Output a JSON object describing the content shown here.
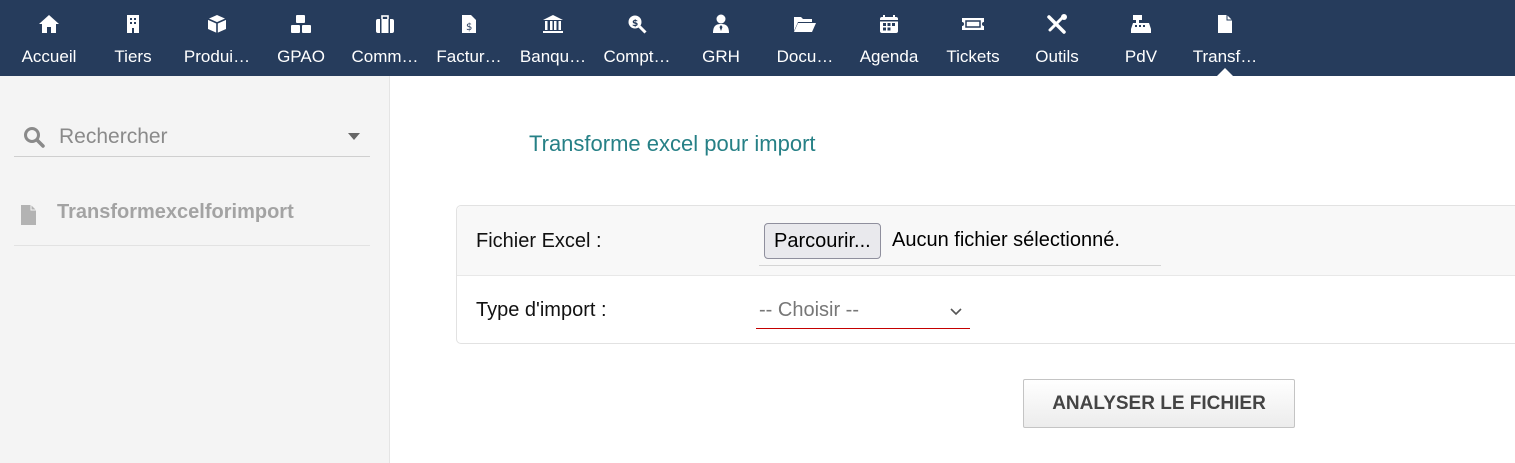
{
  "nav": {
    "items": [
      {
        "label": "Accueil",
        "icon": "home-icon"
      },
      {
        "label": "Tiers",
        "icon": "building-icon"
      },
      {
        "label": "Produi…",
        "icon": "cube-icon"
      },
      {
        "label": "GPAO",
        "icon": "cubes-icon"
      },
      {
        "label": "Comm…",
        "icon": "suitcase-icon"
      },
      {
        "label": "Factur…",
        "icon": "invoice-icon"
      },
      {
        "label": "Banqu…",
        "icon": "bank-icon"
      },
      {
        "label": "Compt…",
        "icon": "search-dollar-icon"
      },
      {
        "label": "GRH",
        "icon": "user-tie-icon"
      },
      {
        "label": "Docu…",
        "icon": "folder-open-icon"
      },
      {
        "label": "Agenda",
        "icon": "calendar-icon"
      },
      {
        "label": "Tickets",
        "icon": "ticket-icon"
      },
      {
        "label": "Outils",
        "icon": "tools-icon"
      },
      {
        "label": "PdV",
        "icon": "cash-register-icon"
      },
      {
        "label": "Transf…",
        "icon": "file-icon"
      }
    ],
    "active_index": 14
  },
  "sidebar": {
    "search_placeholder": "Rechercher",
    "entry_label": "Transformexcelforimport"
  },
  "main": {
    "title": "Transforme excel pour import",
    "file_label": "Fichier Excel :",
    "browse_label": "Parcourir...",
    "file_status": "Aucun fichier sélectionné.",
    "import_type_label": "Type d'import :",
    "import_type_value": "-- Choisir --",
    "analyse_label": "ANALYSER LE FICHIER"
  },
  "colors": {
    "topbar": "#263c5c",
    "title": "#268086",
    "select_underline": "#c40000"
  }
}
